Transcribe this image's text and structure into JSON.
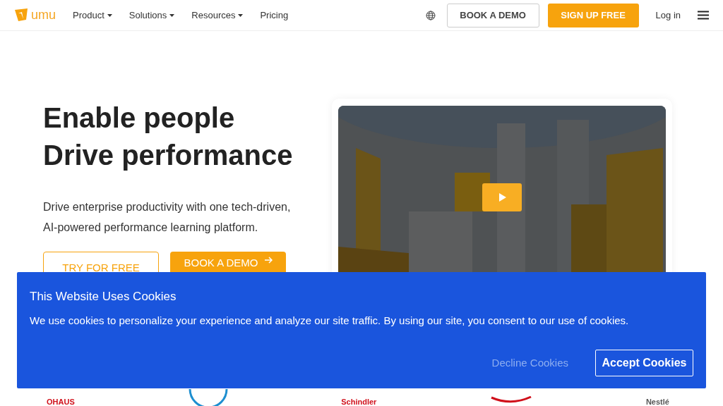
{
  "header": {
    "logo": "umu",
    "nav": [
      {
        "label": "Product",
        "dropdown": true
      },
      {
        "label": "Solutions",
        "dropdown": true
      },
      {
        "label": "Resources",
        "dropdown": true
      },
      {
        "label": "Pricing",
        "dropdown": false
      }
    ],
    "book_demo": "BOOK A DEMO",
    "sign_up": "SIGN UP FREE",
    "login": "Log in"
  },
  "hero": {
    "title_lines": [
      "Enable people",
      "Drive performance"
    ],
    "subtitle_lines": [
      "Drive enterprise productivity with one tech-driven,",
      "AI-powered performance learning platform."
    ],
    "try_button": "TRY FOR FREE",
    "demo_button": "BOOK A DEMO"
  },
  "logos": [
    {
      "kind": "word",
      "text": "OHAUS",
      "color": "#d0101b"
    },
    {
      "kind": "ring",
      "color": "#1e8fd0"
    },
    {
      "kind": "word",
      "text": "Schindler",
      "color": "#d0101b"
    },
    {
      "kind": "swoosh",
      "color": "#d0101b"
    },
    {
      "kind": "word",
      "text": "Nestlé",
      "color": "#555555"
    }
  ],
  "cookie_banner": {
    "title": "This Website Uses Cookies",
    "text": "We use cookies to personalize your experience and analyze our site traffic. By using our site, you consent to our use of cookies.",
    "decline": "Decline Cookies",
    "accept": "Accept Cookies"
  }
}
